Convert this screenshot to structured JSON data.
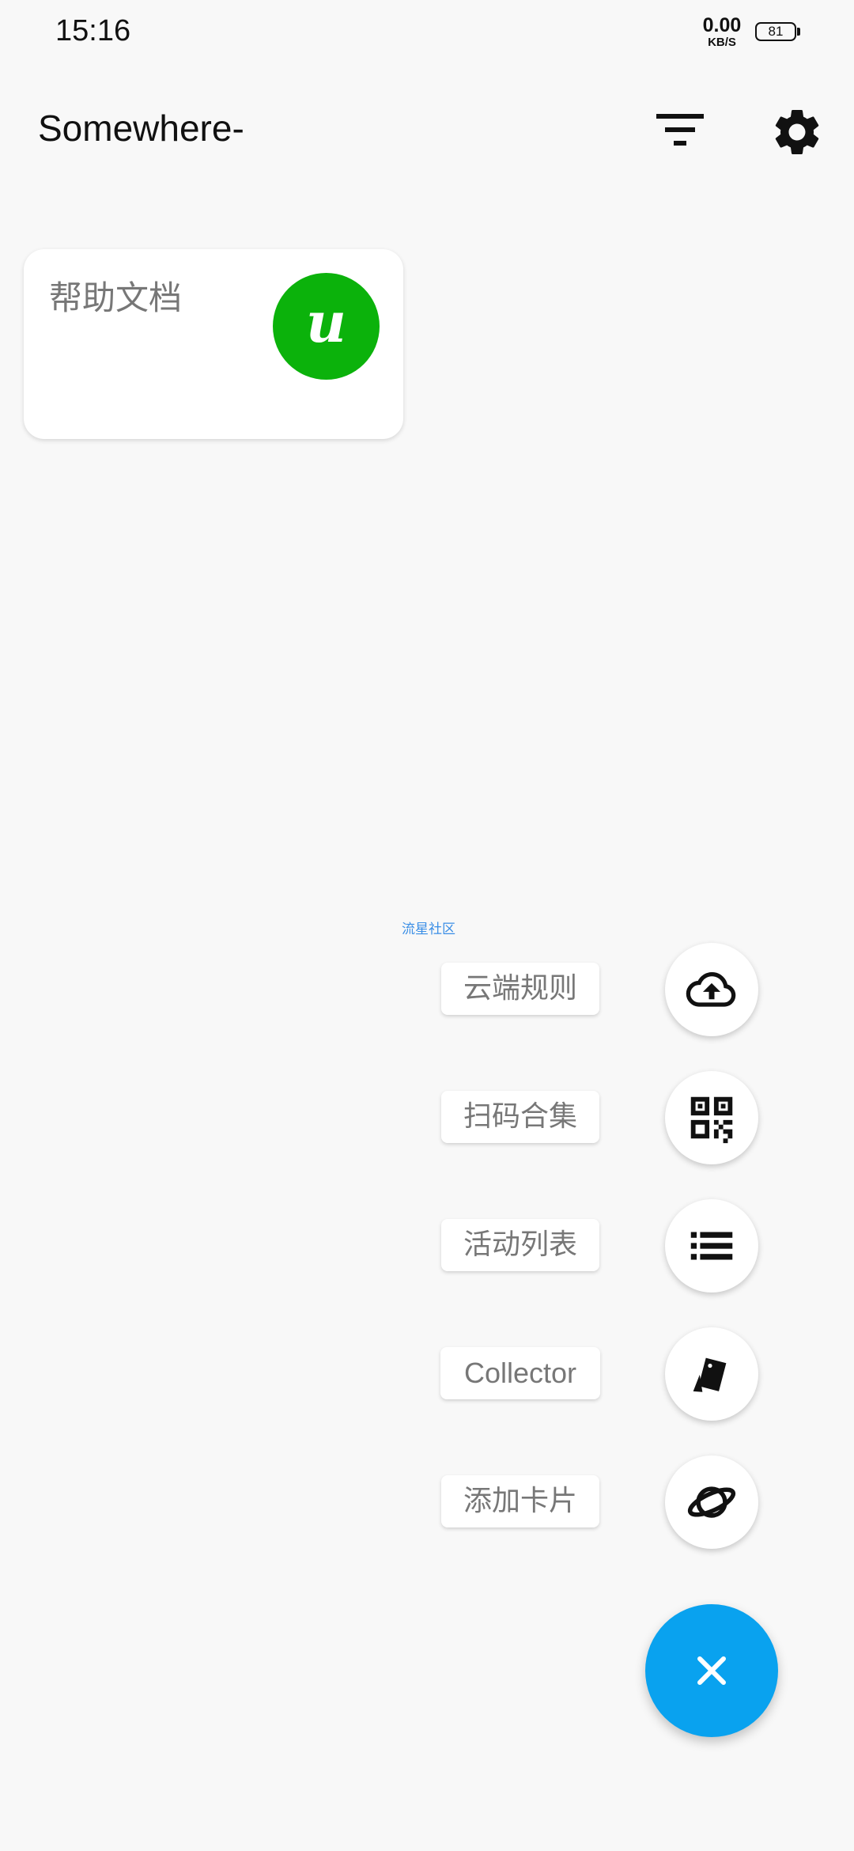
{
  "status_bar": {
    "time": "15:16",
    "net_speed_value": "0.00",
    "net_speed_unit": "KB/S",
    "battery_level": "81"
  },
  "app_bar": {
    "title": "Somewhere-",
    "filter_icon": "filter-icon",
    "settings_icon": "gear-icon"
  },
  "cards": [
    {
      "title": "帮助文档",
      "icon": "u-logo-icon",
      "icon_color": "#0bb20b"
    }
  ],
  "community_link": "流星社区",
  "speed_dial": {
    "items": [
      {
        "label": "云端规则",
        "icon": "cloud-upload-icon"
      },
      {
        "label": "扫码合集",
        "icon": "qr-code-icon"
      },
      {
        "label": "活动列表",
        "icon": "list-icon"
      },
      {
        "label": "Collector",
        "icon": "cards-icon"
      },
      {
        "label": "添加卡片",
        "icon": "planet-icon"
      }
    ],
    "main_fab_icon": "close-icon",
    "main_fab_color": "#09a2ef"
  }
}
